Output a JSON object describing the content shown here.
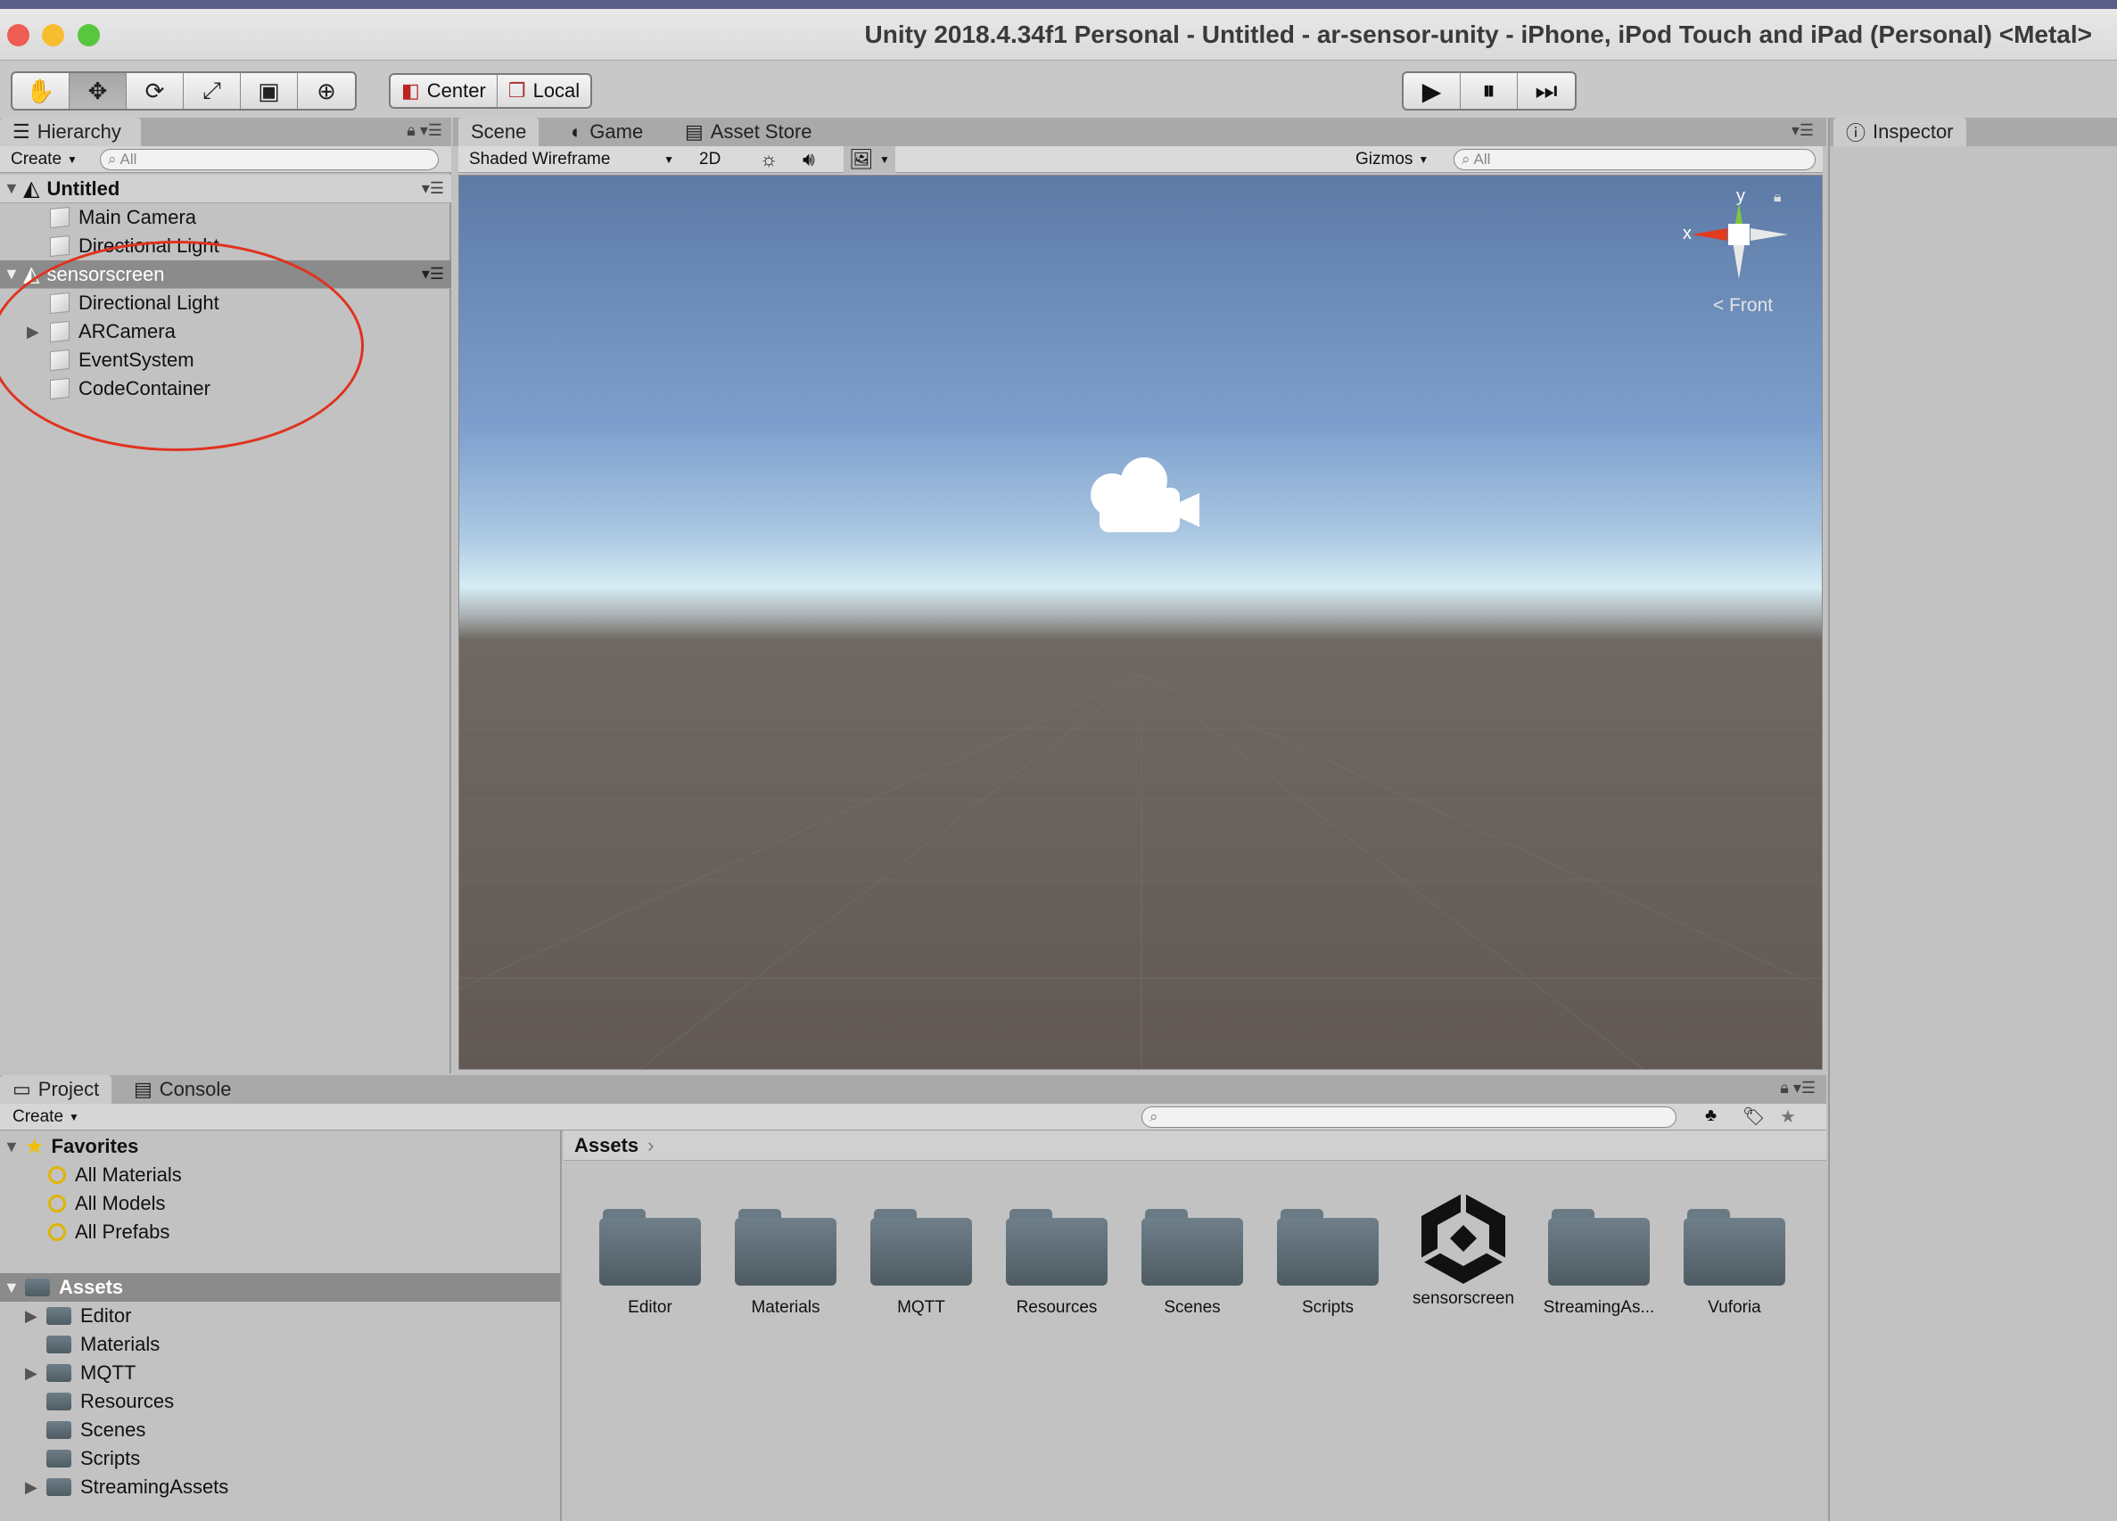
{
  "window": {
    "title": "Unity 2018.4.34f1 Personal - Untitled - ar-sensor-unity - iPhone, iPod Touch and iPad (Personal) <Metal>",
    "traffic_colors": [
      "#ee5c54",
      "#f7bd2f",
      "#59c63f"
    ]
  },
  "toolbar": {
    "tools": [
      "hand-icon",
      "move-icon",
      "rotate-icon",
      "scale-icon",
      "rect-icon",
      "transform-icon"
    ],
    "pivot_center": "Center",
    "pivot_local": "Local",
    "play": [
      "play-icon",
      "pause-icon",
      "step-icon"
    ]
  },
  "hierarchy": {
    "tab": "Hierarchy",
    "create": "Create",
    "search_placeholder": "All",
    "scenes": [
      {
        "name": "Untitled",
        "items": [
          "Main Camera",
          "Directional Light"
        ]
      },
      {
        "name": "sensorscreen",
        "items": [
          "Directional Light",
          "ARCamera",
          "EventSystem",
          "CodeContainer"
        ]
      }
    ]
  },
  "scene_view": {
    "tabs": [
      "Scene",
      "Game",
      "Asset Store"
    ],
    "shading": "Shaded Wireframe",
    "mode_2d": "2D",
    "gizmos": "Gizmos",
    "search_placeholder": "All",
    "gizmo_y": "y",
    "gizmo_x": "x",
    "view_label": "Front"
  },
  "inspector": {
    "tab": "Inspector"
  },
  "project": {
    "tabs": [
      "Project",
      "Console"
    ],
    "create": "Create",
    "favorites_label": "Favorites",
    "favorites": [
      "All Materials",
      "All Models",
      "All Prefabs"
    ],
    "assets_label": "Assets",
    "tree": [
      {
        "name": "Editor",
        "expandable": true
      },
      {
        "name": "Materials",
        "expandable": false
      },
      {
        "name": "MQTT",
        "expandable": true
      },
      {
        "name": "Resources",
        "expandable": false
      },
      {
        "name": "Scenes",
        "expandable": false
      },
      {
        "name": "Scripts",
        "expandable": false
      },
      {
        "name": "StreamingAssets",
        "expandable": true
      }
    ],
    "breadcrumb": "Assets",
    "grid": [
      "Editor",
      "Materials",
      "MQTT",
      "Resources",
      "Scenes",
      "Scripts",
      "sensorscreen",
      "StreamingAs...",
      "Vuforia"
    ]
  }
}
